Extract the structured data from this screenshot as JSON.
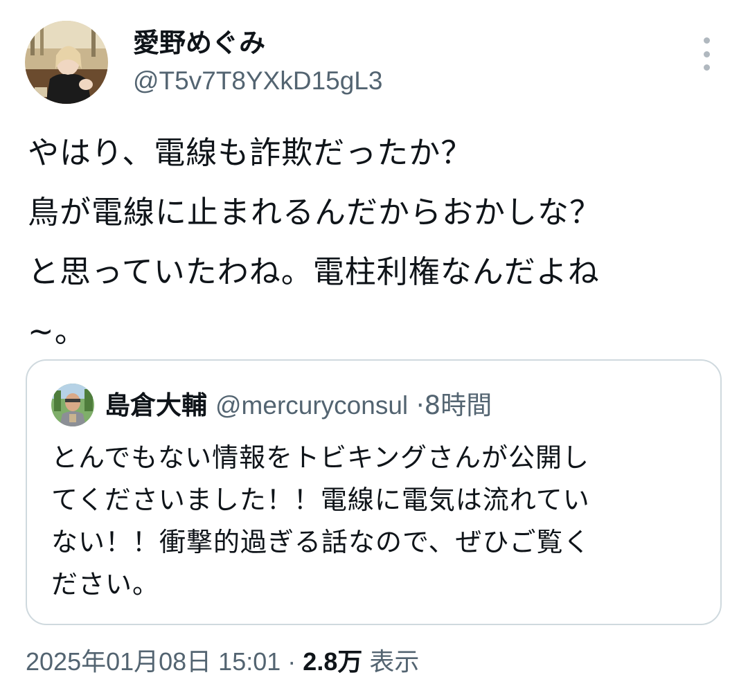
{
  "tweet": {
    "author": {
      "display_name": "愛野めぐみ",
      "handle": "@T5v7T8YXkD15gL3",
      "avatar": "portrait-avatar"
    },
    "more_icon": "more-vertical-icon",
    "text": "やはり、電線も詐欺だったか？\n鳥が電線に止まれるんだからおかしな？\nと思っていたわね。電柱利権なんだよね\n~。",
    "quote": {
      "author": {
        "display_name": "島倉大輔",
        "handle": "@mercuryconsul",
        "avatar": "person-photo-avatar"
      },
      "separator": "·",
      "time": "8時間",
      "text": "とんでもない情報をトビキングさんが公開し\nてくださいました！！電線に電気は流れてい\nない！！衝撃的過ぎる話なので、ぜひご覧く\nださい。"
    },
    "meta": {
      "timestamp": "2025年01月08日 15:01",
      "separator": "·",
      "views_count": "2.8万",
      "views_label": "表示"
    }
  },
  "colors": {
    "text_primary": "#0f1419",
    "text_secondary": "#536471",
    "border": "#cfd9de"
  }
}
